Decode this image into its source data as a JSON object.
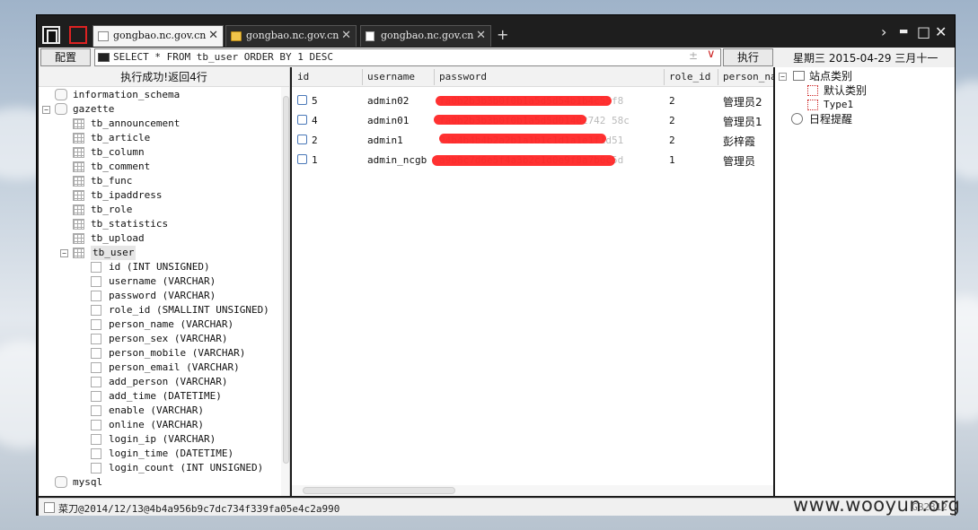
{
  "app": {
    "tabs": [
      {
        "label": "gongbao.nc.gov.cn",
        "icon": "page-icon",
        "active": true
      },
      {
        "label": "gongbao.nc.gov.cn",
        "icon": "folder-icon",
        "active": false
      },
      {
        "label": "gongbao.nc.gov.cn",
        "icon": "document-icon",
        "active": false
      }
    ],
    "new_tab_label": "+",
    "window_controls": {
      "next": "›",
      "minimize": "▬",
      "maximize": "□",
      "close": "✕"
    }
  },
  "toolbar": {
    "config_label": "配置",
    "sql_query": "SELECT * FROM tb_user ORDER BY 1 DESC",
    "plusminus": "±",
    "dropdown": "∨",
    "execute_label": "执行",
    "datetime": "星期三 2015-04-29 三月十一"
  },
  "left": {
    "status": "执行成功!返回4行",
    "tree": [
      {
        "label": "information_schema",
        "type": "db",
        "level": 0,
        "toggle": ""
      },
      {
        "label": "gazette",
        "type": "db",
        "level": 0,
        "toggle": "−"
      },
      {
        "label": "tb_announcement",
        "type": "table",
        "level": 1,
        "toggle": ""
      },
      {
        "label": "tb_article",
        "type": "table",
        "level": 1,
        "toggle": ""
      },
      {
        "label": "tb_column",
        "type": "table",
        "level": 1,
        "toggle": ""
      },
      {
        "label": "tb_comment",
        "type": "table",
        "level": 1,
        "toggle": ""
      },
      {
        "label": "tb_func",
        "type": "table",
        "level": 1,
        "toggle": ""
      },
      {
        "label": "tb_ipaddress",
        "type": "table",
        "level": 1,
        "toggle": ""
      },
      {
        "label": "tb_role",
        "type": "table",
        "level": 1,
        "toggle": ""
      },
      {
        "label": "tb_statistics",
        "type": "table",
        "level": 1,
        "toggle": ""
      },
      {
        "label": "tb_upload",
        "type": "table",
        "level": 1,
        "toggle": ""
      },
      {
        "label": "tb_user",
        "type": "table",
        "level": 1,
        "toggle": "−",
        "selected": true
      },
      {
        "label": "id (INT UNSIGNED)",
        "type": "column",
        "level": 2,
        "toggle": ""
      },
      {
        "label": "username (VARCHAR)",
        "type": "column",
        "level": 2,
        "toggle": ""
      },
      {
        "label": "password (VARCHAR)",
        "type": "column",
        "level": 2,
        "toggle": ""
      },
      {
        "label": "role_id (SMALLINT UNSIGNED)",
        "type": "column",
        "level": 2,
        "toggle": ""
      },
      {
        "label": "person_name (VARCHAR)",
        "type": "column",
        "level": 2,
        "toggle": ""
      },
      {
        "label": "person_sex (VARCHAR)",
        "type": "column",
        "level": 2,
        "toggle": ""
      },
      {
        "label": "person_mobile (VARCHAR)",
        "type": "column",
        "level": 2,
        "toggle": ""
      },
      {
        "label": "person_email (VARCHAR)",
        "type": "column",
        "level": 2,
        "toggle": ""
      },
      {
        "label": "add_person (VARCHAR)",
        "type": "column",
        "level": 2,
        "toggle": ""
      },
      {
        "label": "add_time (DATETIME)",
        "type": "column",
        "level": 2,
        "toggle": ""
      },
      {
        "label": "enable (VARCHAR)",
        "type": "column",
        "level": 2,
        "toggle": ""
      },
      {
        "label": "online (VARCHAR)",
        "type": "column",
        "level": 2,
        "toggle": ""
      },
      {
        "label": "login_ip (VARCHAR)",
        "type": "column",
        "level": 2,
        "toggle": ""
      },
      {
        "label": "login_time (DATETIME)",
        "type": "column",
        "level": 2,
        "toggle": ""
      },
      {
        "label": "login_count (INT UNSIGNED)",
        "type": "column",
        "level": 2,
        "toggle": ""
      },
      {
        "label": "mysql",
        "type": "db",
        "level": 0,
        "toggle": ""
      }
    ]
  },
  "grid": {
    "columns": [
      "id",
      "username",
      "password",
      "role_id",
      "person_nam"
    ],
    "rows": [
      {
        "id": "5",
        "username": "admin02",
        "password": "fa0b2b3b3b0f0b1a5d5d54b1b4c55f8",
        "role_id": "2",
        "person_name": "管理员2"
      },
      {
        "id": "4",
        "username": "admin01",
        "password": "fa0b2b3b3b0f0b1a5d5d01402742 58c",
        "role_id": "2",
        "person_name": "管理员1"
      },
      {
        "id": "2",
        "username": "admin1",
        "password": "94b4b4b4b2a2b1a1b1c1d1a1e1f1d51",
        "role_id": "2",
        "person_name": "彭梓霞"
      },
      {
        "id": "1",
        "username": "admin_ncgb",
        "password": "a9b8c7d6e5f4a3b2c1d0e9f8a7b6c5d",
        "role_id": "1",
        "person_name": "管理员"
      }
    ]
  },
  "right": {
    "tree": [
      {
        "label": "站点类别",
        "icon": "site-node-icon",
        "toggle": "−",
        "level": 0
      },
      {
        "label": "默认类别",
        "icon": "category-icon",
        "toggle": "",
        "level": 1
      },
      {
        "label": "Type1",
        "icon": "category-icon",
        "toggle": "",
        "level": 1
      },
      {
        "label": "日程提醒",
        "icon": "schedule-icon",
        "toggle": "+",
        "level": 0
      }
    ]
  },
  "statusbar": {
    "text": "菜刀@2014/12/13@4b4a956b9c7dc734f339fa05e4c2a990",
    "right": "GB2312"
  },
  "watermark": "www.wooyun.org"
}
